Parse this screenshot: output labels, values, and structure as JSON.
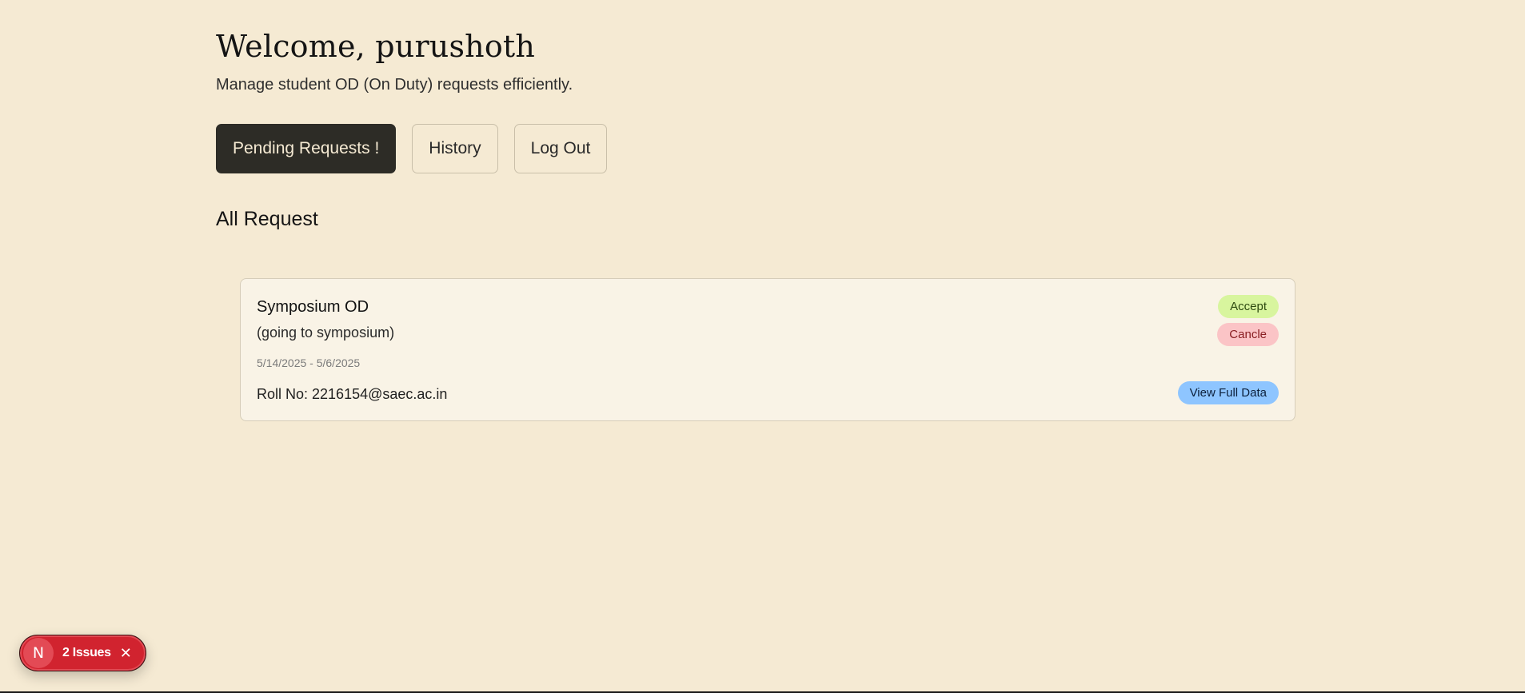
{
  "header": {
    "title": "Welcome, purushoth",
    "subtitle": "Manage student OD (On Duty) requests efficiently."
  },
  "nav": {
    "pending_label": "Pending Requests !",
    "history_label": "History",
    "logout_label": "Log Out"
  },
  "section": {
    "title": "All Request"
  },
  "requests": [
    {
      "title": "Symposium OD",
      "description": "(going to symposium)",
      "dates": "5/14/2025 - 5/6/2025",
      "roll": "Roll No: 2216154@saec.ac.in",
      "accept_label": "Accept",
      "cancel_label": "Cancle",
      "view_label": "View Full Data"
    }
  ],
  "dev_overlay": {
    "logo_letter": "N",
    "issues_label": "2 Issues",
    "close_glyph": "✕"
  },
  "colors": {
    "background": "#f5ead3",
    "active_button": "#2d2c26",
    "accept": "#d8f59e",
    "cancel": "#fbc4c6",
    "view": "#8ec5ff",
    "issues_badge": "#d1232f"
  }
}
